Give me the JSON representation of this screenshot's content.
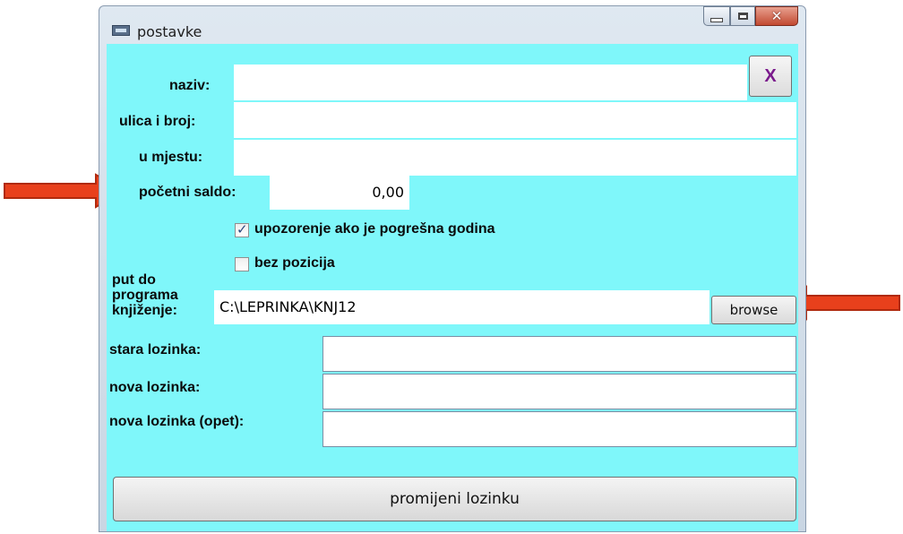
{
  "window": {
    "title": "postavke"
  },
  "close_button_label": "X",
  "form": {
    "naziv_label": "naziv:",
    "naziv_value": "",
    "ulica_label": "ulica i broj:",
    "ulica_value": "",
    "mjesto_label": "u mjestu:",
    "mjesto_value": "",
    "saldo_label": "početni saldo:",
    "saldo_value": "0,00",
    "upozorenje_label": "upozorenje ako je pogrešna godina",
    "upozorenje_checked": true,
    "bez_pozicija_label": "bez pozicija",
    "bez_pozicija_checked": false,
    "put_label_1": "put do",
    "put_label_2": "programa",
    "put_label_3": "knjiženje:",
    "put_value": "C:\\LEPRINKA\\KNJ12",
    "browse_label": "browse",
    "stara_label": "stara lozinka:",
    "stara_value": "",
    "nova_label": "nova lozinka:",
    "nova_value": "",
    "nova_opet_label": "nova lozinka (opet):",
    "nova_opet_value": "",
    "change_button_label": "promijeni lozinku"
  },
  "colors": {
    "client_bg": "#7ff7fa",
    "arrow": "#e8401c",
    "close_x": "#7a1a8c"
  },
  "annotations": [
    "left-arrow pointing at početni saldo",
    "right-arrow pointing at browse button"
  ]
}
